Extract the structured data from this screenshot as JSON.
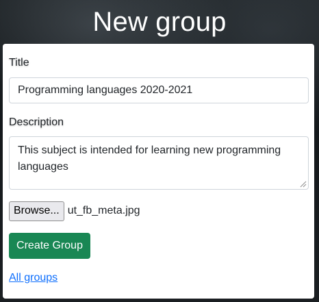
{
  "page": {
    "title": "New group"
  },
  "form": {
    "title_label": "Title",
    "title_value": "Programming languages 2020-2021",
    "description_label": "Description",
    "description_value": "This subject is intended for learning new programming languages",
    "browse_label": "Browse...",
    "file_name": "ut_fb_meta.jpg",
    "submit_label": "Create Group"
  },
  "links": {
    "all_groups": "All groups"
  },
  "colors": {
    "submit_bg": "#198754",
    "link": "#0d6efd"
  }
}
